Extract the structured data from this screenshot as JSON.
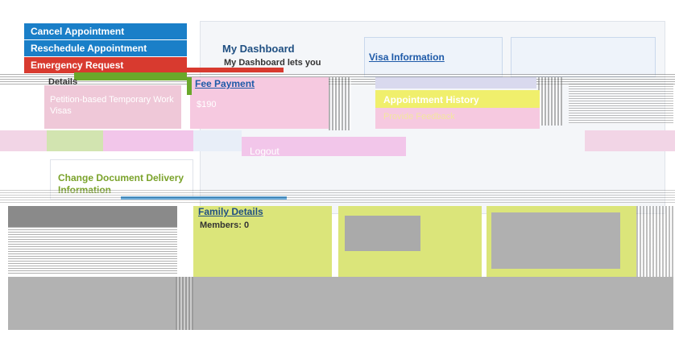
{
  "sidebar": {
    "cancel_appointment": "Cancel Appointment",
    "reschedule_appointment": "Reschedule Appointment",
    "emergency_request": "Emergency Request"
  },
  "dashboard": {
    "title": "My Dashboard",
    "intro": "My Dashboard lets you"
  },
  "visa_info": {
    "link": "Visa Information",
    "category_label": "Details",
    "category_value": "Petition-based Temporary Work Visas"
  },
  "fee": {
    "link": "Fee Payment",
    "amount": "$190"
  },
  "menu": {
    "appointment_history": "Appointment History",
    "provide_feedback": "Provide Feedback",
    "logout": "Logout"
  },
  "delivery": {
    "change_link": "Change Document Delivery Information"
  },
  "family": {
    "title": "Family Details",
    "members_label": "Members: 0"
  },
  "colors": {
    "accent_blue": "#1a7fc8",
    "emergency_red": "#d83a2f",
    "highlight_green": "#dbe57a",
    "heading_blue": "#1f4f82"
  }
}
